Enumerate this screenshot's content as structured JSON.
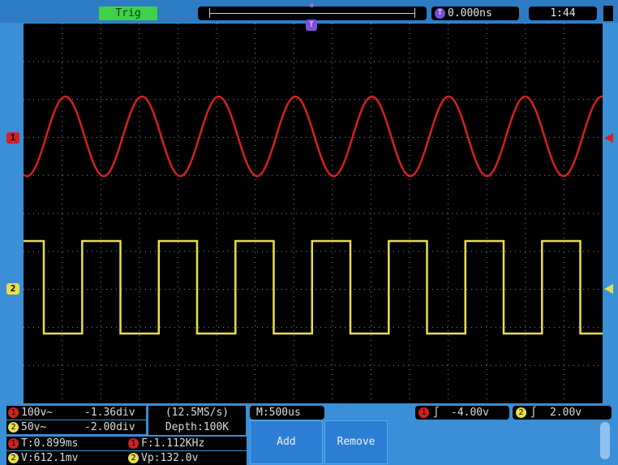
{
  "topbar": {
    "trig_status": "Trig",
    "trigger_delay_icon": "T",
    "trigger_delay": "0.000ns",
    "clock": "1:44"
  },
  "screen": {
    "trigger_marker": "T",
    "ch1_marker": "1",
    "ch2_marker": "2",
    "colors": {
      "ch1": "#d42020",
      "ch2": "#e6e04a",
      "background": "#000000",
      "grid": "#8a8a8a"
    }
  },
  "status": {
    "ch1": {
      "icon": "1",
      "scale": "100v~",
      "offset": "-1.36div"
    },
    "ch2": {
      "icon": "2",
      "scale": "50v~",
      "offset": "-2.00div"
    },
    "sample_rate": "(12.5MS/s)",
    "depth": "Depth:100K",
    "timebase": "M:500us",
    "trigger_ch1": {
      "icon": "1",
      "slope": "∫",
      "level": "-4.00v"
    },
    "trigger_ch2": {
      "icon": "2",
      "slope": "∫",
      "level": "2.00v"
    },
    "measure_ch1_time": {
      "icon": "1",
      "text": "T:0.899ms"
    },
    "measure_ch1_freq": {
      "icon": "1",
      "text": "F:1.112KHz"
    },
    "measure_ch2_v": {
      "icon": "2",
      "text": "V:612.1mv"
    },
    "measure_ch2_vp": {
      "icon": "2",
      "text": "Vp:132.0v"
    }
  },
  "softkeys": {
    "add_label": "Add",
    "remove_label": "Remove"
  }
}
